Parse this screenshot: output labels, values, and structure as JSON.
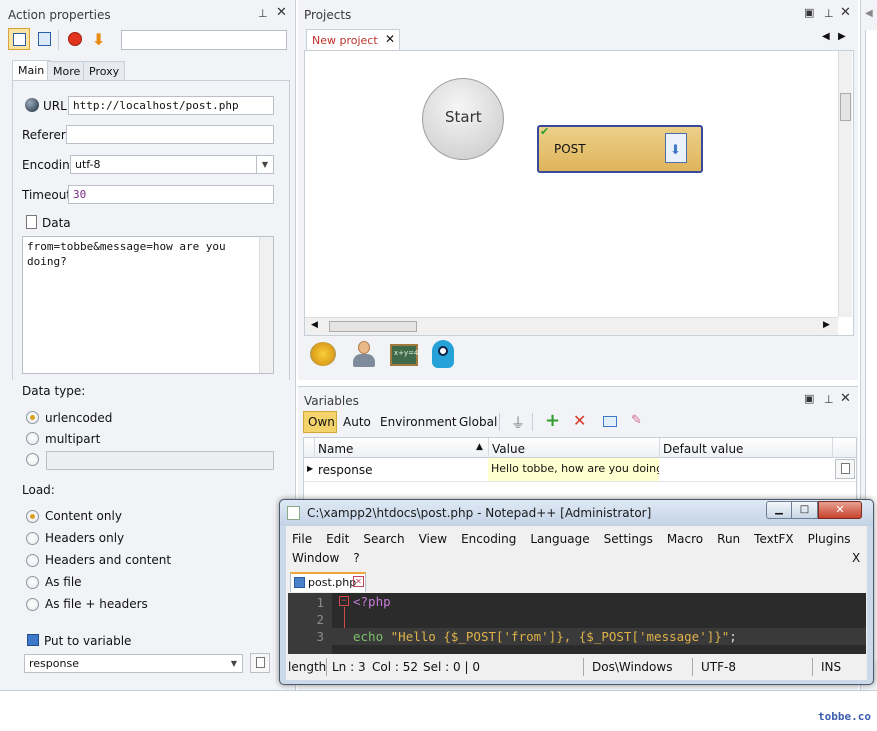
{
  "action_panel": {
    "title": "Action properties",
    "tabs": [
      "Main",
      "More",
      "Proxy"
    ],
    "url_label": "URL",
    "url_value": "http://localhost/post.php",
    "referer_label": "Referer",
    "referer_value": "",
    "encoding_label": "Encoding",
    "encoding_value": "utf-8",
    "timeout_label": "Timeout",
    "timeout_value": "30",
    "data_label": "Data",
    "data_value": "from=tobbe&message=how are you doing?",
    "data_type_label": "Data type:",
    "data_type_options": [
      "urlencoded",
      "multipart"
    ],
    "data_type_selected": "urlencoded",
    "load_label": "Load:",
    "load_options": [
      "Content only",
      "Headers only",
      "Headers and content",
      "As file",
      "As file + headers"
    ],
    "load_selected": "Content only",
    "put_to_variable_label": "Put to variable",
    "variable_value": "response"
  },
  "projects_panel": {
    "title": "Projects",
    "tab_label": "New project",
    "start_node": "Start",
    "post_node": "POST"
  },
  "variables_panel": {
    "title": "Variables",
    "filters": [
      "Own",
      "Auto",
      "Environment",
      "Global"
    ],
    "columns": [
      "Name",
      "Value",
      "Default value"
    ],
    "rows": [
      {
        "name": "response",
        "value": "Hello tobbe, how are you doing?",
        "default": ""
      }
    ]
  },
  "notepad": {
    "title": "C:\\xampp2\\htdocs\\post.php - Notepad++ [Administrator]",
    "menu_row1": [
      "File",
      "Edit",
      "Search",
      "View",
      "Encoding",
      "Language",
      "Settings",
      "Macro",
      "Run",
      "TextFX",
      "Plugins"
    ],
    "menu_row2": [
      "Window",
      "?"
    ],
    "close_x": "X",
    "tab_label": "post.php",
    "line_numbers": [
      "1",
      "2",
      "3"
    ],
    "code_line1": "<?php",
    "code_line3_a": "echo ",
    "code_line3_b": "\"Hello {$_POST['from']}, {$_POST['message']}\"",
    "code_line3_c": ";",
    "status": {
      "length": "length",
      "ln": "Ln : 3",
      "col": "Col : 52",
      "sel": "Sel : 0 | 0",
      "eol": "Dos\\Windows",
      "encoding": "UTF-8",
      "mode": "INS"
    }
  },
  "watermark": "tobbe.co",
  "colors": {
    "post_node_bg": "#e8c572",
    "post_node_border": "#3a4a9a",
    "own_filter_bg": "#f5d36b",
    "value_cell_bg": "#ffffcf",
    "editor_bg": "#2b2b2b",
    "php_tag": "#c57bd6",
    "string": "#e0b24a"
  }
}
